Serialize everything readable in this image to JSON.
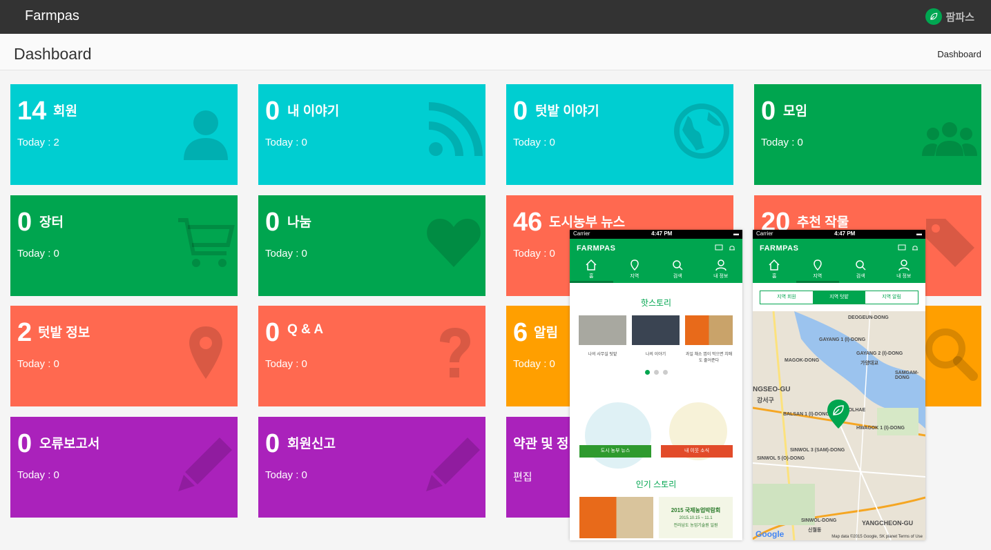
{
  "topbar": {
    "brand": "Farmpas",
    "user_name": "팜파스"
  },
  "header": {
    "title": "Dashboard",
    "breadcrumb": "Dashboard"
  },
  "colors": {
    "cyan": "#00ced1",
    "green": "#00a54f",
    "coral": "#ff6950",
    "orange": "#ff9f00",
    "purple": "#aa22bb"
  },
  "tiles": [
    {
      "count": "14",
      "label": "회원",
      "sub": "Today : 2",
      "icon": "user-icon",
      "color": "cyan"
    },
    {
      "count": "0",
      "label": "내 이야기",
      "sub": "Today : 0",
      "icon": "rss-icon",
      "color": "cyan"
    },
    {
      "count": "0",
      "label": "텃밭 이야기",
      "sub": "Today : 0",
      "icon": "globe-icon",
      "color": "cyan"
    },
    {
      "count": "0",
      "label": "모임",
      "sub": "Today : 0",
      "icon": "group-icon",
      "color": "green"
    },
    {
      "count": "0",
      "label": "장터",
      "sub": "Today : 0",
      "icon": "cart-icon",
      "color": "green"
    },
    {
      "count": "0",
      "label": "나눔",
      "sub": "Today : 0",
      "icon": "heart-icon",
      "color": "green"
    },
    {
      "count": "46",
      "label": "도시농부 뉴스",
      "sub": "Today : 0",
      "icon": "pin-icon",
      "color": "coral"
    },
    {
      "count": "20",
      "label": "추천 작물",
      "sub": "",
      "icon": "tag-icon",
      "color": "coral"
    },
    {
      "count": "2",
      "label": "텃밭 정보",
      "sub": "Today : 0",
      "icon": "map-marker-icon",
      "color": "coral"
    },
    {
      "count": "0",
      "label": "Q & A",
      "sub": "Today : 0",
      "icon": "question-icon",
      "color": "coral"
    },
    {
      "count": "6",
      "label": "알림",
      "sub": "Today : 0",
      "icon": "bell-icon",
      "color": "orange"
    },
    {
      "count": "",
      "label": "",
      "sub": "",
      "icon": "search-icon",
      "color": "orange"
    },
    {
      "count": "0",
      "label": "오류보고서",
      "sub": "Today : 0",
      "icon": "pencil-icon",
      "color": "purple"
    },
    {
      "count": "0",
      "label": "회원신고",
      "sub": "Today : 0",
      "icon": "pencil-icon",
      "color": "purple"
    },
    {
      "count": "",
      "label": "약관 및 정",
      "sub": "편집",
      "icon": "",
      "color": "purple"
    }
  ],
  "phone_home": {
    "carrier": "Carrier",
    "time": "4:47 PM",
    "logo": "FARMPAS",
    "tabs": [
      "홈",
      "지역",
      "검색",
      "내 정보"
    ],
    "hot_title": "핫스토리",
    "hot_items": [
      "나의 사무실 텃밭",
      "나의 이야기",
      "과일 채소 껍이 먹으면 치매도 줄어준다"
    ],
    "banner_left": "도시 농부 뉴스",
    "banner_right": "내 이웃 소식",
    "popular_title": "인기 스토리",
    "expo_title": "2015 국제농업박람회",
    "expo_dates": "2015.10.15 ~ 11.1",
    "expo_place": "전라남도 농업기술원 일원"
  },
  "phone_map": {
    "carrier": "Carrier",
    "time": "4:47 PM",
    "logo": "FARMPAS",
    "tabs": [
      "홈",
      "지역",
      "검색",
      "내 정보"
    ],
    "segments": [
      "지역 회원",
      "지역 텃밭",
      "지역 알림"
    ],
    "labels": [
      "DEOGEUN-DONG",
      "GAYANG 1 (I)-DONG",
      "GAYANG 2 (I)-DONG",
      "MAGOK-DONG",
      "가양대교",
      "SAMGAM-DONG",
      "NGSEO-GU",
      "강서구",
      "BALSAN 1 (I)-DONG",
      "WOLHAE",
      "HWAGOK 1 (I)-DONG",
      "SINWOL 5 (O)-DONG",
      "SINWOL 3 (SAM)-DONG",
      "YANGCHEON-GU",
      "SINWOL-DONG",
      "신월동"
    ],
    "google": "Google",
    "attribution": "Map data ©2015 Google, SK planet  Terms of Use"
  }
}
